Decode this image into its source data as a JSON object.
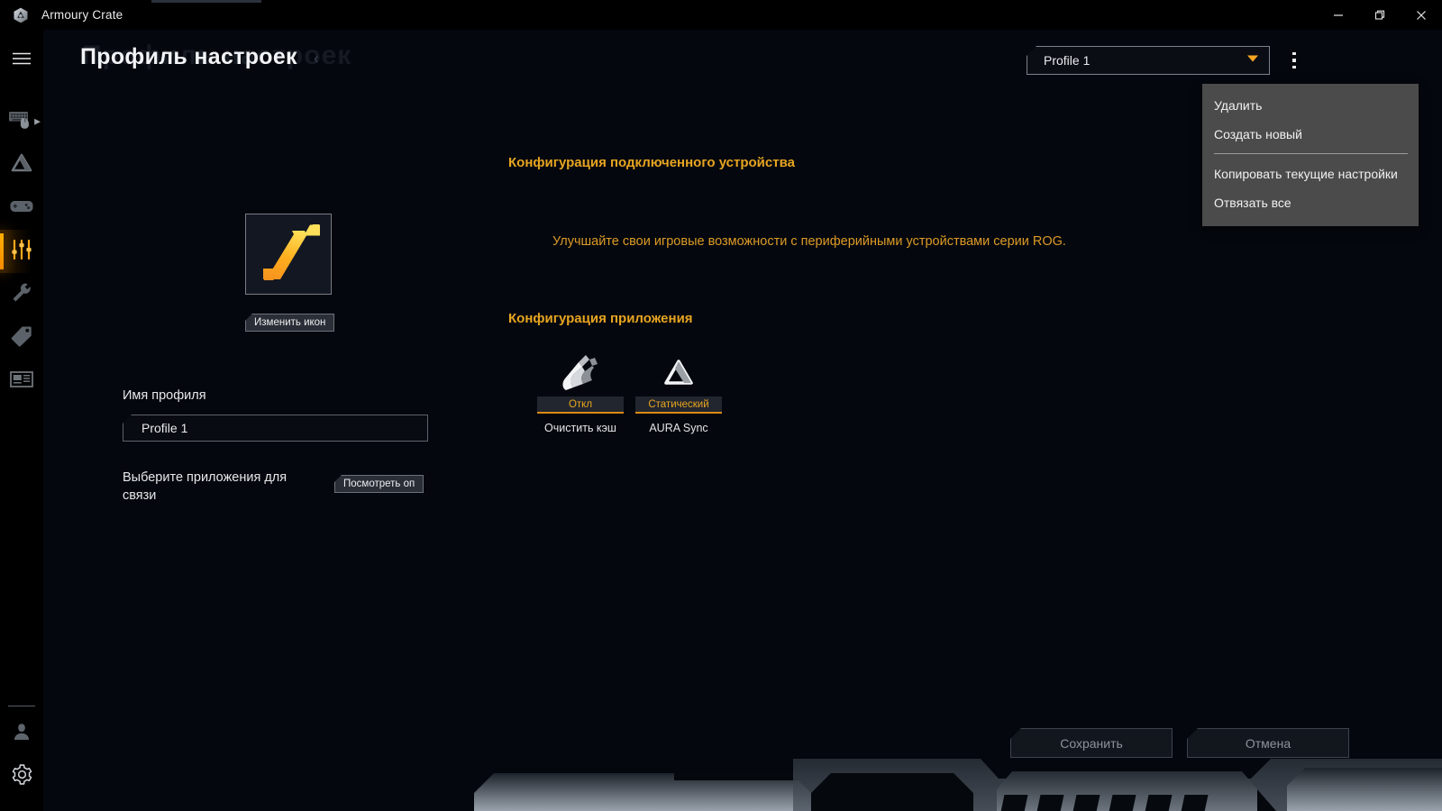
{
  "window": {
    "app_title": "Armoury Crate",
    "logo_icon": "armoury-crate-logo",
    "minimize_icon": "minimize-icon",
    "maximize_icon": "restore-icon",
    "close_icon": "close-icon"
  },
  "sidebar": {
    "menu_icon": "hamburger-icon",
    "items": [
      {
        "icon": "keyboard-mouse-icon",
        "name": "devices",
        "active": false,
        "has_chevron": true
      },
      {
        "icon": "aura-triangle-icon",
        "name": "aura-sync",
        "active": false,
        "has_chevron": false
      },
      {
        "icon": "gamepad-icon",
        "name": "game-profiles",
        "active": false,
        "has_chevron": false
      },
      {
        "icon": "sliders-icon",
        "name": "profile-settings",
        "active": true,
        "has_chevron": false
      },
      {
        "icon": "wrench-icon",
        "name": "tools",
        "active": false,
        "has_chevron": false
      },
      {
        "icon": "tag-icon",
        "name": "deals",
        "active": false,
        "has_chevron": false
      },
      {
        "icon": "news-icon",
        "name": "news",
        "active": false,
        "has_chevron": false
      }
    ],
    "bottom_items": [
      {
        "icon": "user-icon",
        "name": "user-account"
      },
      {
        "icon": "gear-icon",
        "name": "settings"
      }
    ]
  },
  "header": {
    "title": "Профиль настроек",
    "ghost_title": "Профиль настроек",
    "caret": "‹",
    "profile_select": {
      "value": "Profile 1",
      "arrow_icon": "chevron-down-icon"
    },
    "kebab_icon": "more-options-icon"
  },
  "context_menu": {
    "items": [
      {
        "label": "Удалить",
        "name": "menu-delete"
      },
      {
        "label": "Создать новый",
        "name": "menu-create-new"
      },
      {
        "label": "Копировать текущие настройки",
        "name": "menu-copy-current-settings"
      },
      {
        "label": "Отвязать все",
        "name": "menu-unlink-all"
      }
    ],
    "separator_after_index": 1
  },
  "left_panel": {
    "profile_icon": "profile-slash-icon",
    "change_icon_button": "Изменить икон",
    "profile_name_label": "Имя профиля",
    "profile_name_value": "Profile 1",
    "profile_name_placeholder": "Profile 1",
    "link_apps_label": "Выберите приложения для связи",
    "view_apps_button": "Посмотреть оп"
  },
  "main": {
    "device_config_title": "Конфигурация подключенного устройства",
    "device_hint": "Улучшайте свои игровые возможности с периферийными устройствами серии ROG.",
    "app_config_title": "Конфигурация приложения",
    "tiles": [
      {
        "name": "clear-cache",
        "icon": "broom-icon",
        "state": "Откл",
        "label": "Очистить кэш"
      },
      {
        "name": "aura-sync",
        "icon": "aura-triangle-icon",
        "state": "Статический",
        "label": "AURA Sync"
      }
    ]
  },
  "footer": {
    "save_label": "Сохранить",
    "cancel_label": "Отмена"
  },
  "colors": {
    "accent_orange": "#e8a521",
    "accent_amber": "#ffb300",
    "background": "#04070d",
    "sidebar": "#000000",
    "menu_bg": "#4b4b4b",
    "close_hover": "#c42b1c"
  }
}
